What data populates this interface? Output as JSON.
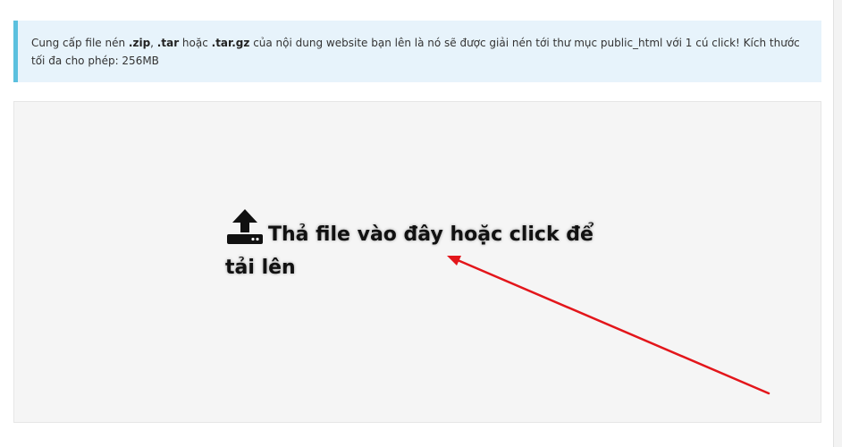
{
  "notice": {
    "text_1": "Cung cấp file nén ",
    "ext_zip": ".zip",
    "sep_1": ", ",
    "ext_tar": ".tar",
    "text_2": " hoặc ",
    "ext_targz": ".tar.gz",
    "text_3": " của nội dung website bạn lên là nó sẽ được giải nén tới thư mục public_html với 1 cú click! Kích thước tối đa cho phép: 256MB"
  },
  "dropzone": {
    "icon": "upload-icon",
    "message": "Thả file vào đây hoặc click để tải lên"
  },
  "annotation": {
    "type": "red-arrow",
    "color": "#e3161b"
  }
}
